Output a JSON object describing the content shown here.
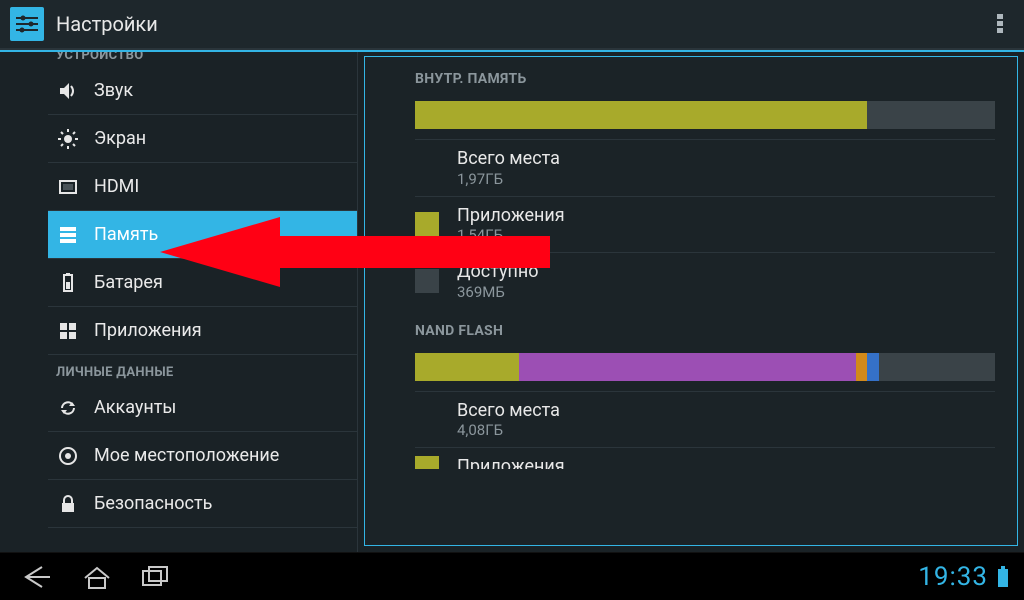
{
  "app": {
    "title": "Настройки"
  },
  "categories": {
    "device": "УСТРОЙСТВО",
    "personal": "ЛИЧНЫЕ ДАННЫЕ"
  },
  "sidebar": {
    "items": [
      {
        "label": "Звук"
      },
      {
        "label": "Экран"
      },
      {
        "label": "HDMI"
      },
      {
        "label": "Память",
        "selected": true
      },
      {
        "label": "Батарея"
      },
      {
        "label": "Приложения"
      },
      {
        "label": "Аккаунты"
      },
      {
        "label": "Мое местоположение"
      },
      {
        "label": "Безопасность"
      }
    ]
  },
  "storage": {
    "internal": {
      "header": "ВНУТР. ПАМЯТЬ",
      "total": {
        "label": "Всего места",
        "value": "1,97ГБ"
      },
      "apps": {
        "label": "Приложения",
        "value": "1,54ГБ"
      },
      "avail": {
        "label": "Доступно",
        "value": "369МБ"
      },
      "bar": {
        "fill_pct": 78,
        "fill_color": "#a8aa2b",
        "track_color": "#3a4348"
      }
    },
    "nand": {
      "header": "NAND FLASH",
      "total": {
        "label": "Всего места",
        "value": "4,08ГБ"
      },
      "apps": {
        "label": "Приложения"
      },
      "segments": [
        {
          "color": "#a8aa2b",
          "pct": 18
        },
        {
          "color": "#9c4fb4",
          "pct": 58
        },
        {
          "color": "#d28a1b",
          "pct": 2
        },
        {
          "color": "#3571c8",
          "pct": 2
        },
        {
          "color": "#3a4348",
          "pct": 20
        }
      ]
    }
  },
  "statusbar": {
    "time": "19:33"
  }
}
